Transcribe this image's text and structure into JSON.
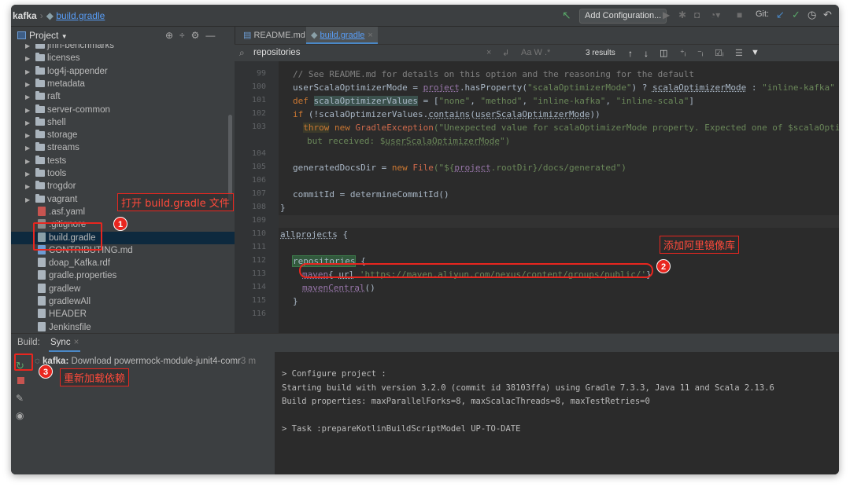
{
  "breadcrumb": {
    "project": "kafka",
    "file": "build.gradle"
  },
  "toolbar": {
    "add_configuration": "Add Configuration...",
    "git_label": "Git:"
  },
  "project_panel": {
    "title": "Project",
    "items": [
      {
        "type": "folder",
        "label": "jmh-benchmarks"
      },
      {
        "type": "folder",
        "label": "licenses"
      },
      {
        "type": "folder",
        "label": "log4j-appender"
      },
      {
        "type": "folder",
        "label": "metadata"
      },
      {
        "type": "folder",
        "label": "raft"
      },
      {
        "type": "folder",
        "label": "server-common"
      },
      {
        "type": "folder",
        "label": "shell"
      },
      {
        "type": "folder",
        "label": "storage"
      },
      {
        "type": "folder",
        "label": "streams"
      },
      {
        "type": "folder",
        "label": "tests"
      },
      {
        "type": "folder",
        "label": "tools"
      },
      {
        "type": "folder",
        "label": "trogdor"
      },
      {
        "type": "folder",
        "label": "vagrant"
      },
      {
        "type": "file",
        "label": ".asf.yaml"
      },
      {
        "type": "file",
        "label": ".gitignore"
      },
      {
        "type": "file",
        "label": "build.gradle",
        "selected": true
      },
      {
        "type": "file",
        "label": "CONTRIBUTING.md"
      },
      {
        "type": "file",
        "label": "doap_Kafka.rdf"
      },
      {
        "type": "file",
        "label": "gradle.properties"
      },
      {
        "type": "file",
        "label": "gradlew"
      },
      {
        "type": "file",
        "label": "gradlewAll"
      },
      {
        "type": "file",
        "label": "HEADER"
      },
      {
        "type": "file",
        "label": "Jenkinsfile"
      }
    ]
  },
  "tabs": [
    {
      "label": "README.md",
      "active": false
    },
    {
      "label": "build.gradle",
      "active": true
    }
  ],
  "search": {
    "query": "repositories",
    "results": "3 results",
    "opts": "Aa  W  .*"
  },
  "code": {
    "line_numbers": [
      "99",
      "100",
      "101",
      "102",
      "103",
      "",
      "104",
      "105",
      "106",
      "107",
      "108",
      "109",
      "110",
      "111",
      "112",
      "113",
      "114",
      "115",
      "116"
    ],
    "line99": "// See README.md for details on this option and the reasoning for the default",
    "l100_a": "userScalaOptimizerMode = ",
    "l100_b": "project",
    "l100_c": ".hasProperty(",
    "l100_d": "\"scalaOptimizerMode\"",
    "l100_e": ") ? ",
    "l100_f": "scalaOptimizerMode",
    "l100_g": " : ",
    "l100_h": "\"inline-kafka\"",
    "l101_kw": "def ",
    "l101_var": "scalaOptimizerValues",
    "l101_eq": " = [",
    "l101_s1": "\"none\"",
    "l101_s2": "\"method\"",
    "l101_s3": "\"inline-kafka\"",
    "l101_s4": "\"inline-scala\"",
    "l101_end": "]",
    "l102_kw": "if ",
    "l102_a": "(!scalaOptimizerValues.",
    "l102_b": "contains",
    "l102_c": "(",
    "l102_d": "userScalaOptimizerMode",
    "l102_e": "))",
    "l103_kw1": "throw",
    "l103_kw2": " new ",
    "l103_cls": "GradleException",
    "l103_str": "(\"Unexpected value for scalaOptimizerMode property. Expected one of $scalaOptimi",
    "l103w_str": "but received: $",
    "l103w_var": "userScalaOptimizerMode",
    "l103w_end": "\")",
    "l105_a": "generatedDocsDir = ",
    "l105_kw": "new ",
    "l105_cls": "File",
    "l105_s1": "(\"${",
    "l105_p": "project",
    "l105_s2": ".rootDir}/docs/generated\")",
    "l107": "commitId = determineCommitId()",
    "l108": "}",
    "l110_a": "allprojects",
    "l110_b": " {",
    "l112_a": "repositories",
    "l112_b": " {",
    "l113_a": "maven",
    "l113_b": "{ ",
    "l113_c": "url",
    "l113_d": " 'https://maven.aliyun.com/nexus/content/groups/public/'",
    "l113_e": "}",
    "l114": "mavenCentral",
    "l114_end": "()",
    "l115": "}"
  },
  "build": {
    "title": "Build:",
    "tab": "Sync",
    "task_name": "kafka:",
    "task_desc": "Download powermock-module-junit4-comr",
    "task_time": "3 m",
    "console": [
      "> Configure project :",
      "Starting build with version 3.2.0 (commit id 38103ffa) using Gradle 7.3.3, Java 11 and Scala 2.13.6",
      "Build properties: maxParallelForks=8, maxScalacThreads=8, maxTestRetries=0",
      "",
      "> Task :prepareKotlinBuildScriptModel UP-TO-DATE"
    ]
  },
  "annotations": {
    "n1": "1",
    "n2": "2",
    "n3": "3",
    "note1": "打开 build.gradle 文件",
    "note2": "添加阿里镜像库",
    "note3": "重新加载依赖"
  }
}
